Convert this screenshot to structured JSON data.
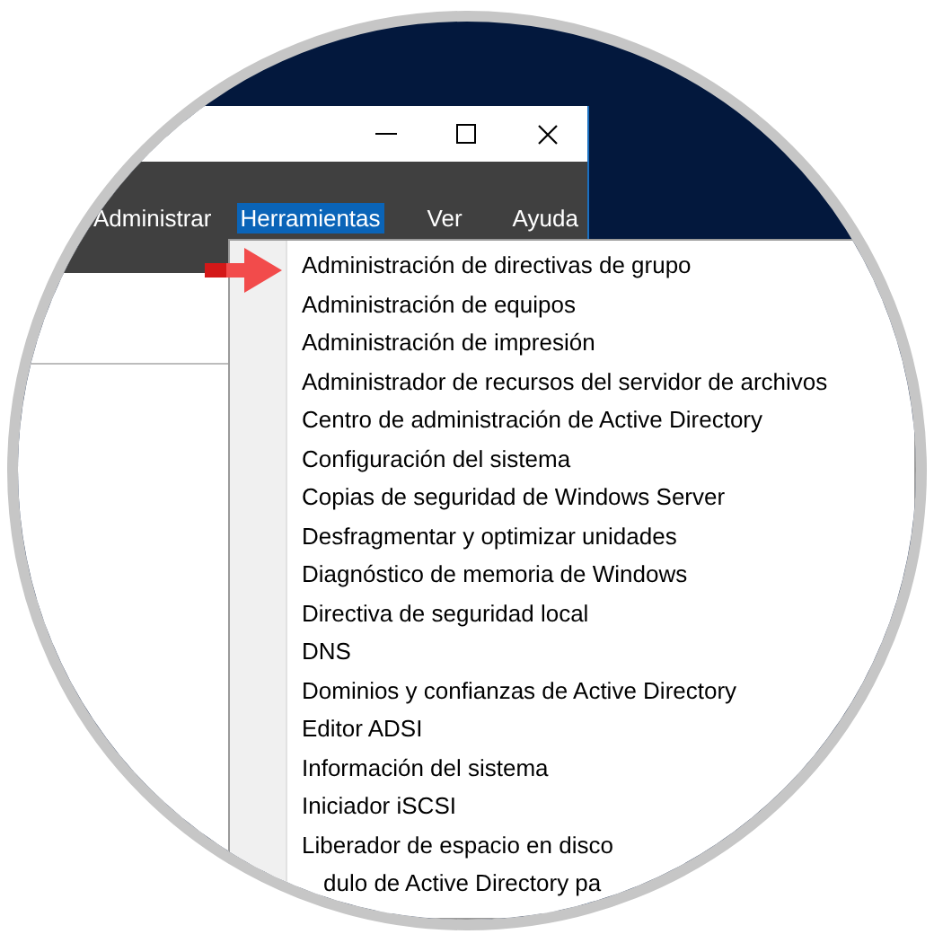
{
  "menu_bar": [
    {
      "label": "Administrar",
      "selected": false
    },
    {
      "label": "Herramientas",
      "selected": true
    },
    {
      "label": "Ver",
      "selected": false
    },
    {
      "label": "Ayuda",
      "selected": false
    }
  ],
  "dropdown": {
    "items": [
      {
        "label": "Administración de directivas de grupo"
      },
      {
        "label": "Administración de equipos"
      },
      {
        "label": "Administración de impresión"
      },
      {
        "label": "Administrador de recursos del servidor de archivos"
      },
      {
        "label": "Centro de administración de Active Directory"
      },
      {
        "label": "Configuración del sistema"
      },
      {
        "label": "Copias de seguridad de Windows Server"
      },
      {
        "label": "Desfragmentar y optimizar unidades"
      },
      {
        "label": "Diagnóstico de memoria de Windows"
      },
      {
        "label": "Directiva de seguridad local"
      },
      {
        "label": "DNS"
      },
      {
        "label": "Dominios y confianzas de Active Directory"
      },
      {
        "label": "Editor ADSI"
      },
      {
        "label": "Información del sistema"
      },
      {
        "label": "Iniciador iSCSI"
      },
      {
        "label": "Liberador de espacio en disco"
      },
      {
        "label": "dulo de Active Directory pa",
        "kind": "clipped"
      }
    ]
  }
}
